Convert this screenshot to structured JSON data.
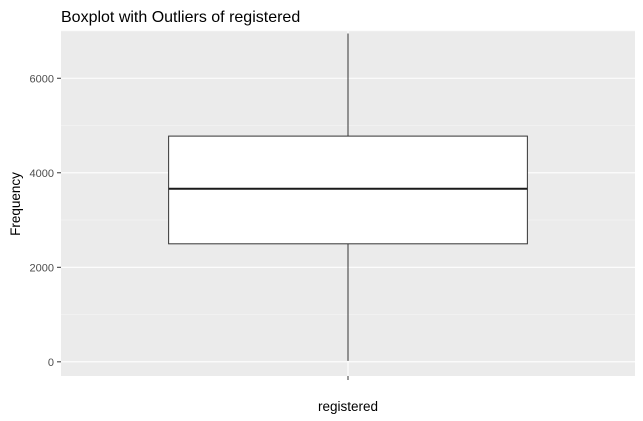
{
  "chart_data": {
    "type": "boxplot",
    "title": "Boxplot with Outliers of  registered",
    "xlabel": "registered",
    "ylabel": "Frequency",
    "categories": [
      "registered"
    ],
    "ylim": [
      -300,
      7000
    ],
    "yticks": [
      0,
      2000,
      4000,
      6000
    ],
    "ytick_labels": [
      "0",
      "2000",
      "4000",
      "6000"
    ],
    "grid": true,
    "boxes": [
      {
        "name": "registered",
        "whisker_low": 20,
        "q1": 2497,
        "median": 3662,
        "q3": 4776,
        "whisker_high": 6946
      }
    ],
    "outliers": []
  },
  "colors": {
    "panel_background": "#ebebeb",
    "grid_major": "#ffffff",
    "grid_minor": "#f5f5f5",
    "box_fill": "#ffffff",
    "box_stroke": "#333333"
  }
}
